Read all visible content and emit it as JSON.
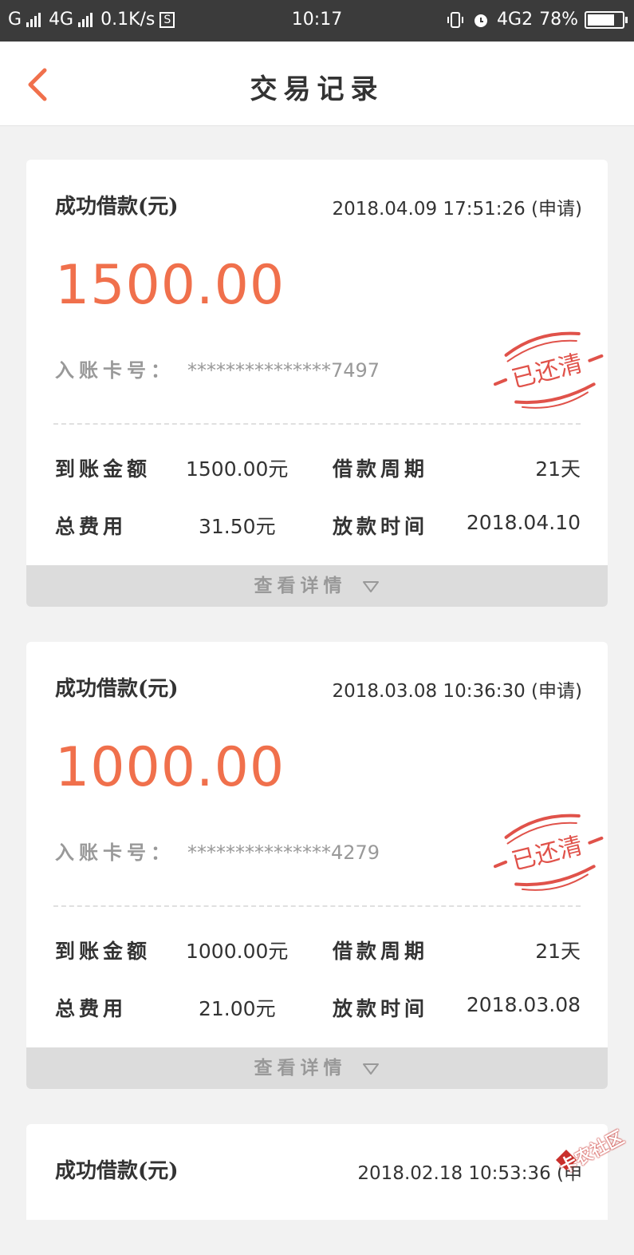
{
  "status_bar": {
    "carrier1": "G",
    "carrier2": "4G",
    "speed": "0.1K/s",
    "s_badge": "S",
    "time": "10:17",
    "net": "4G2",
    "battery": "78%",
    "battery_level": 0.78
  },
  "header": {
    "title": "交易记录"
  },
  "colors": {
    "accent": "#f0704c",
    "stamp": "#e0524a"
  },
  "records": [
    {
      "label": "成功借款(元)",
      "datetime": "2018.04.09 17:51:26 (申请)",
      "amount": "1500.00",
      "account_label": "入账卡号：",
      "account": "***************7497",
      "stamp": "已还清",
      "received_label": "到账金额",
      "received": "1500.00元",
      "period_label": "借款周期",
      "period": "21天",
      "fee_label": "总费用",
      "fee": "31.50元",
      "loan_time_label": "放款时间",
      "loan_time": "2018.04.10",
      "details": "查看详情"
    },
    {
      "label": "成功借款(元)",
      "datetime": "2018.03.08 10:36:30 (申请)",
      "amount": "1000.00",
      "account_label": "入账卡号：",
      "account": "***************4279",
      "stamp": "已还清",
      "received_label": "到账金额",
      "received": "1000.00元",
      "period_label": "借款周期",
      "period": "21天",
      "fee_label": "总费用",
      "fee": "21.00元",
      "loan_time_label": "放款时间",
      "loan_time": "2018.03.08",
      "details": "查看详情"
    },
    {
      "label": "成功借款(元)",
      "datetime": "2018.02.18 10:53:36 (申"
    }
  ],
  "watermark": "卡农社区"
}
